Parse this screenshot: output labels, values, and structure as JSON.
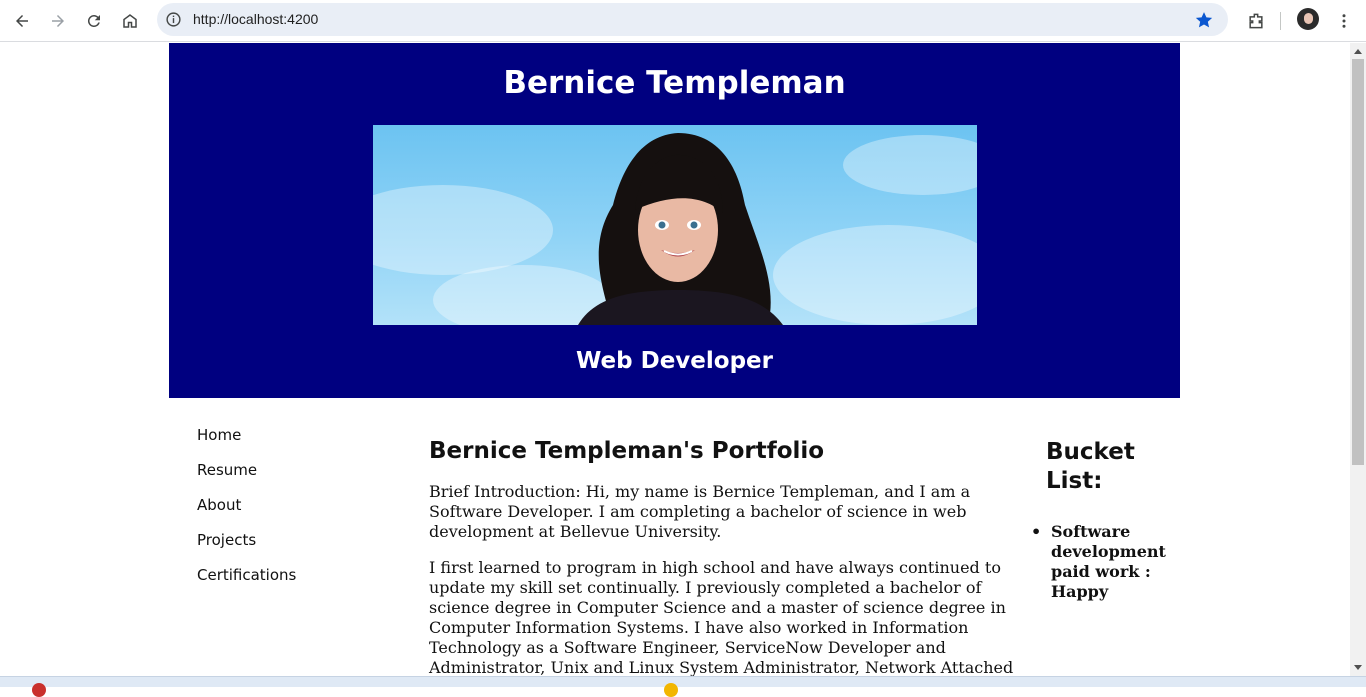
{
  "browser": {
    "url": "http://localhost:4200",
    "colors": {
      "star": "#0b57d0",
      "omnibox_bg": "#e9eef6"
    }
  },
  "page": {
    "header": {
      "name": "Bernice Templeman",
      "role": "Web Developer",
      "bg_color": "#000080",
      "photo_alt": "Bernice Templeman portrait"
    },
    "nav": {
      "items": [
        {
          "label": "Home"
        },
        {
          "label": "Resume"
        },
        {
          "label": "About"
        },
        {
          "label": "Projects"
        },
        {
          "label": "Certifications"
        }
      ]
    },
    "main": {
      "title": "Bernice Templeman's Portfolio",
      "intro": "Brief Introduction: Hi, my name is Bernice Templeman, and I am a Software Developer. I am completing a bachelor of science in web development at Bellevue University.",
      "paragraph2": "I first learned to program in high school and have always continued to update my skill set continually. I previously completed a bachelor of science degree in Computer Science and a master of science degree in Computer Information Systems. I have also worked in Information Technology as a Software Engineer, ServiceNow Developer and Administrator, Unix and Linux System Administrator, Network Attached Storage Technical Suppor"
    },
    "bucket": {
      "title": "Bucket List:",
      "items": [
        {
          "label": "Software development paid work : Happy"
        }
      ]
    }
  }
}
